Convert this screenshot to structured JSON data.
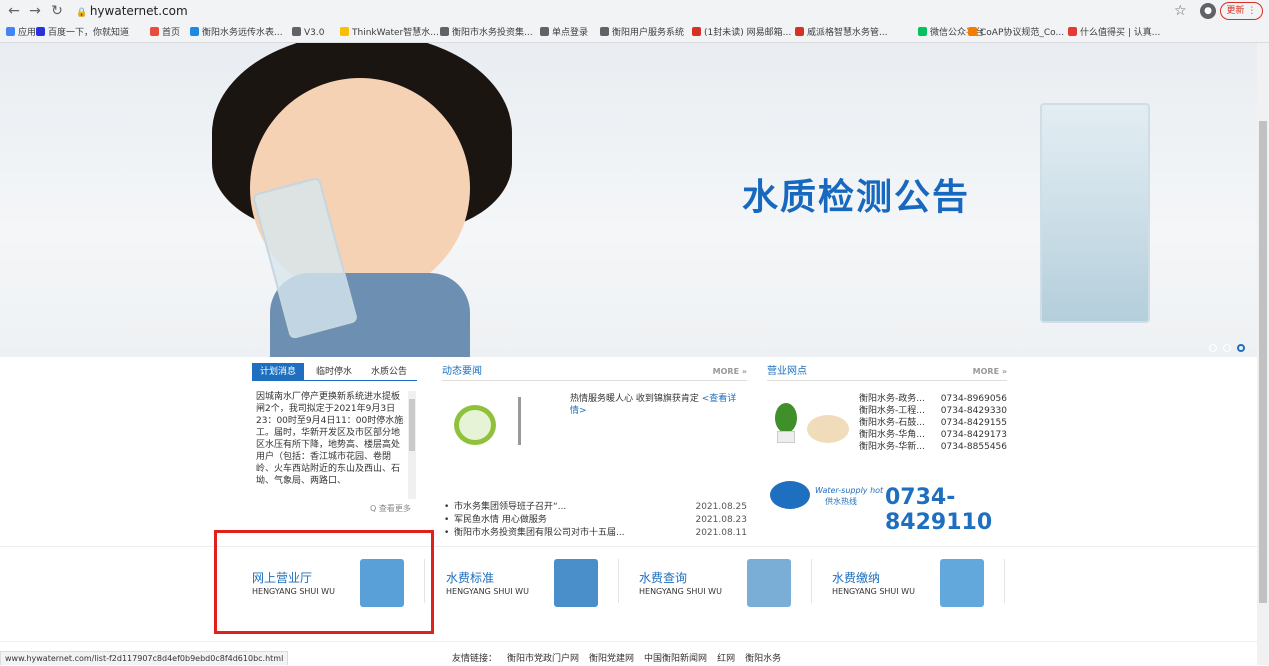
{
  "browser": {
    "url": "hywaternet.com",
    "update_label": "更新",
    "bookmarks": [
      {
        "label": "应用",
        "color": "#4285f4"
      },
      {
        "label": "百度一下，你就知道",
        "color": "#2932e1"
      },
      {
        "label": "首页",
        "color": "#e94b3c"
      },
      {
        "label": "衡阳水务远传水表...",
        "color": "#1e88e5"
      },
      {
        "label": "V3.0",
        "color": "#5f6368"
      },
      {
        "label": "ThinkWater智慧水...",
        "color": "#fbbc04"
      },
      {
        "label": "衡阳市水务投资集...",
        "color": "#5f6368"
      },
      {
        "label": "单点登录",
        "color": "#5f6368"
      },
      {
        "label": "衡阳用户服务系统",
        "color": "#5f6368"
      },
      {
        "label": "(1封未读) 网易邮箱...",
        "color": "#d93025"
      },
      {
        "label": "威派格智慧水务管...",
        "color": "#d93025"
      },
      {
        "label": "微信公众平台",
        "color": "#07c160"
      },
      {
        "label": "CoAP协议规范_Co...",
        "color": "#f57c00"
      },
      {
        "label": "什么值得买 | 认真...",
        "color": "#e53935"
      }
    ],
    "status_url": "www.hywaternet.com/list-f2d117907c8d4ef0b9ebd0c8f4d610bc.html"
  },
  "banner": {
    "title": "水质检测公告"
  },
  "col1": {
    "tabs": [
      "计划消息",
      "临时停水",
      "水质公告"
    ],
    "notice": "因城南水厂停产更换新系统进水提板闸2个，我司拟定于2021年9月3日23：00时至9月4日11：00时停水施工。届时，华新开发区及市区部分地区水压有所下降，地势高、楼层高处用户（包括：香江城市花园、卷閉岭、火车西站附近的东山及西山、石坳、气象局、两路口、",
    "more": "Q 查看更多"
  },
  "col2": {
    "title": "动态要闻",
    "more": "MORE »",
    "headline": "热情服务暖人心 收到锦旗获肯定",
    "headline_link": "<查看详情>",
    "items": [
      {
        "text": "市水务集团领导班子召开“...",
        "date": "2021.08.25"
      },
      {
        "text": "军民鱼水情 用心做服务",
        "date": "2021.08.23"
      },
      {
        "text": "衡阳市水务投资集团有限公司对市十五届...",
        "date": "2021.08.11"
      }
    ]
  },
  "col3": {
    "title": "营业网点",
    "more": "MORE »",
    "sites": [
      {
        "name": "衡阳水务-政务...",
        "phone": "0734-8969056"
      },
      {
        "name": "衡阳水务-工程...",
        "phone": "0734-8429330"
      },
      {
        "name": "衡阳水务-石鼓...",
        "phone": "0734-8429155"
      },
      {
        "name": "衡阳水务-华角...",
        "phone": "0734-8429173"
      },
      {
        "name": "衡阳水务-华新...",
        "phone": "0734-8855456"
      }
    ],
    "hotline_en": "Water-supply hot",
    "hotline_cn": "供水热线",
    "hotline": "0734-8429110"
  },
  "services": [
    {
      "title": "网上营业厅",
      "sub": "HENGYANG SHUI WU",
      "icon": "clipboard-icon",
      "color": "#5aa0d8"
    },
    {
      "title": "水费标准",
      "sub": "HENGYANG SHUI WU",
      "icon": "bar-chart-icon",
      "color": "#4a8fc9"
    },
    {
      "title": "水费查询",
      "sub": "HENGYANG SHUI WU",
      "icon": "magnifier-icon",
      "color": "#7aaed6"
    },
    {
      "title": "水费缴纳",
      "sub": "HENGYANG SHUI WU",
      "icon": "envelope-icon",
      "color": "#62a8dc"
    }
  ],
  "footer": {
    "label": "友情链接：",
    "links": [
      "衡阳市党政门户网",
      "衡阳党建网",
      "中国衡阳新闻网",
      "红网",
      "衡阳水务"
    ]
  },
  "colors": {
    "accent": "#1e6fbf",
    "highlight": "#e0201a"
  }
}
